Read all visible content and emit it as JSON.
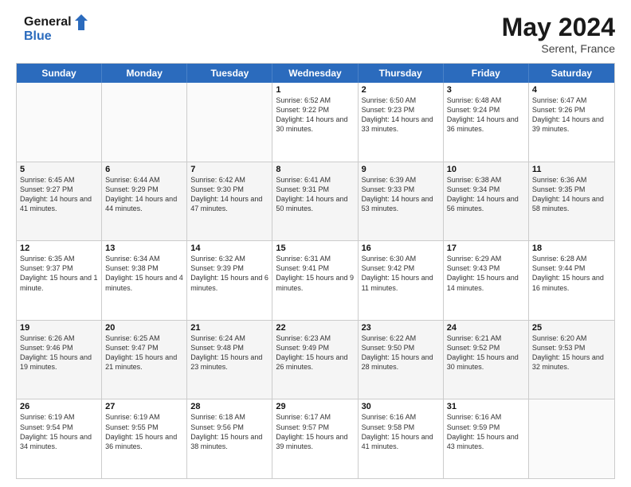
{
  "logo": {
    "line1": "General",
    "line2": "Blue"
  },
  "header": {
    "month_year": "May 2024",
    "location": "Serent, France"
  },
  "days_of_week": [
    "Sunday",
    "Monday",
    "Tuesday",
    "Wednesday",
    "Thursday",
    "Friday",
    "Saturday"
  ],
  "weeks": [
    [
      {
        "day": "",
        "info": ""
      },
      {
        "day": "",
        "info": ""
      },
      {
        "day": "",
        "info": ""
      },
      {
        "day": "1",
        "info": "Sunrise: 6:52 AM\nSunset: 9:22 PM\nDaylight: 14 hours and 30 minutes."
      },
      {
        "day": "2",
        "info": "Sunrise: 6:50 AM\nSunset: 9:23 PM\nDaylight: 14 hours and 33 minutes."
      },
      {
        "day": "3",
        "info": "Sunrise: 6:48 AM\nSunset: 9:24 PM\nDaylight: 14 hours and 36 minutes."
      },
      {
        "day": "4",
        "info": "Sunrise: 6:47 AM\nSunset: 9:26 PM\nDaylight: 14 hours and 39 minutes."
      }
    ],
    [
      {
        "day": "5",
        "info": "Sunrise: 6:45 AM\nSunset: 9:27 PM\nDaylight: 14 hours and 41 minutes."
      },
      {
        "day": "6",
        "info": "Sunrise: 6:44 AM\nSunset: 9:29 PM\nDaylight: 14 hours and 44 minutes."
      },
      {
        "day": "7",
        "info": "Sunrise: 6:42 AM\nSunset: 9:30 PM\nDaylight: 14 hours and 47 minutes."
      },
      {
        "day": "8",
        "info": "Sunrise: 6:41 AM\nSunset: 9:31 PM\nDaylight: 14 hours and 50 minutes."
      },
      {
        "day": "9",
        "info": "Sunrise: 6:39 AM\nSunset: 9:33 PM\nDaylight: 14 hours and 53 minutes."
      },
      {
        "day": "10",
        "info": "Sunrise: 6:38 AM\nSunset: 9:34 PM\nDaylight: 14 hours and 56 minutes."
      },
      {
        "day": "11",
        "info": "Sunrise: 6:36 AM\nSunset: 9:35 PM\nDaylight: 14 hours and 58 minutes."
      }
    ],
    [
      {
        "day": "12",
        "info": "Sunrise: 6:35 AM\nSunset: 9:37 PM\nDaylight: 15 hours and 1 minute."
      },
      {
        "day": "13",
        "info": "Sunrise: 6:34 AM\nSunset: 9:38 PM\nDaylight: 15 hours and 4 minutes."
      },
      {
        "day": "14",
        "info": "Sunrise: 6:32 AM\nSunset: 9:39 PM\nDaylight: 15 hours and 6 minutes."
      },
      {
        "day": "15",
        "info": "Sunrise: 6:31 AM\nSunset: 9:41 PM\nDaylight: 15 hours and 9 minutes."
      },
      {
        "day": "16",
        "info": "Sunrise: 6:30 AM\nSunset: 9:42 PM\nDaylight: 15 hours and 11 minutes."
      },
      {
        "day": "17",
        "info": "Sunrise: 6:29 AM\nSunset: 9:43 PM\nDaylight: 15 hours and 14 minutes."
      },
      {
        "day": "18",
        "info": "Sunrise: 6:28 AM\nSunset: 9:44 PM\nDaylight: 15 hours and 16 minutes."
      }
    ],
    [
      {
        "day": "19",
        "info": "Sunrise: 6:26 AM\nSunset: 9:46 PM\nDaylight: 15 hours and 19 minutes."
      },
      {
        "day": "20",
        "info": "Sunrise: 6:25 AM\nSunset: 9:47 PM\nDaylight: 15 hours and 21 minutes."
      },
      {
        "day": "21",
        "info": "Sunrise: 6:24 AM\nSunset: 9:48 PM\nDaylight: 15 hours and 23 minutes."
      },
      {
        "day": "22",
        "info": "Sunrise: 6:23 AM\nSunset: 9:49 PM\nDaylight: 15 hours and 26 minutes."
      },
      {
        "day": "23",
        "info": "Sunrise: 6:22 AM\nSunset: 9:50 PM\nDaylight: 15 hours and 28 minutes."
      },
      {
        "day": "24",
        "info": "Sunrise: 6:21 AM\nSunset: 9:52 PM\nDaylight: 15 hours and 30 minutes."
      },
      {
        "day": "25",
        "info": "Sunrise: 6:20 AM\nSunset: 9:53 PM\nDaylight: 15 hours and 32 minutes."
      }
    ],
    [
      {
        "day": "26",
        "info": "Sunrise: 6:19 AM\nSunset: 9:54 PM\nDaylight: 15 hours and 34 minutes."
      },
      {
        "day": "27",
        "info": "Sunrise: 6:19 AM\nSunset: 9:55 PM\nDaylight: 15 hours and 36 minutes."
      },
      {
        "day": "28",
        "info": "Sunrise: 6:18 AM\nSunset: 9:56 PM\nDaylight: 15 hours and 38 minutes."
      },
      {
        "day": "29",
        "info": "Sunrise: 6:17 AM\nSunset: 9:57 PM\nDaylight: 15 hours and 39 minutes."
      },
      {
        "day": "30",
        "info": "Sunrise: 6:16 AM\nSunset: 9:58 PM\nDaylight: 15 hours and 41 minutes."
      },
      {
        "day": "31",
        "info": "Sunrise: 6:16 AM\nSunset: 9:59 PM\nDaylight: 15 hours and 43 minutes."
      },
      {
        "day": "",
        "info": ""
      }
    ]
  ]
}
